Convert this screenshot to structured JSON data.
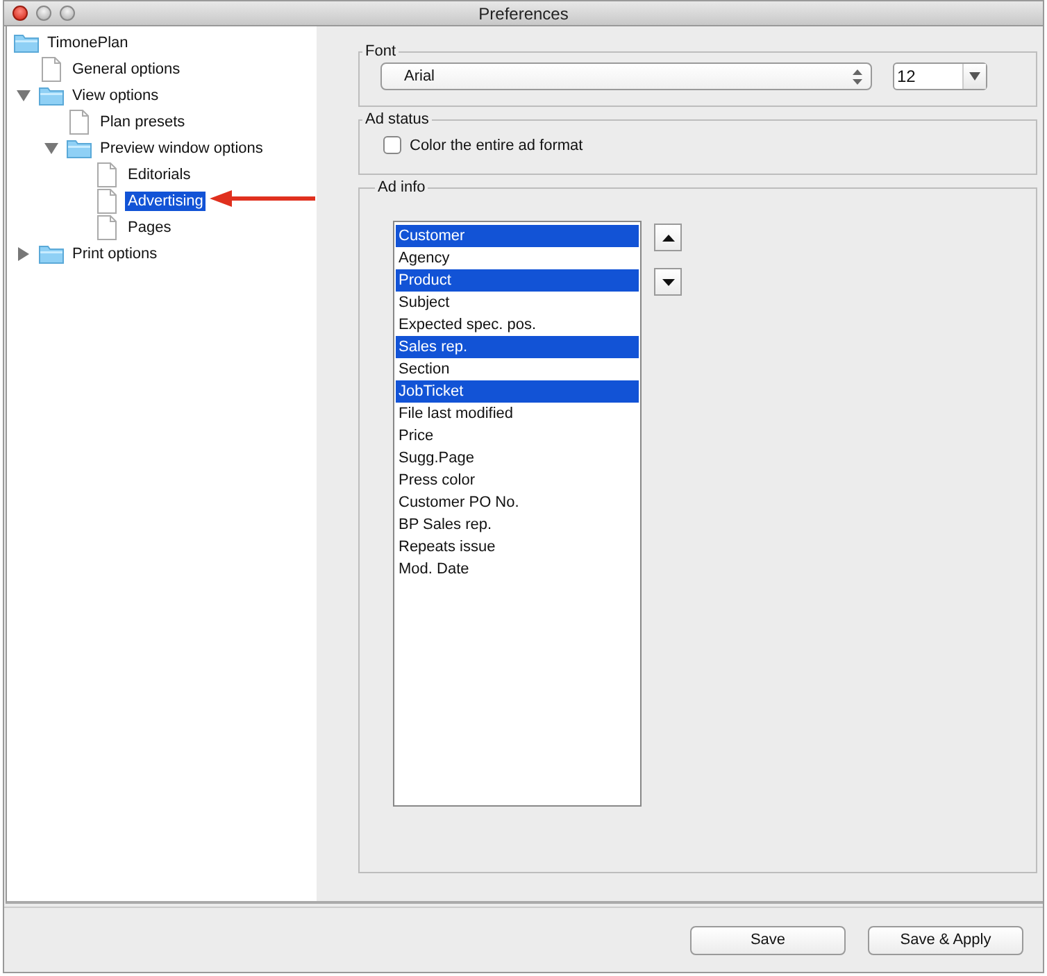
{
  "window": {
    "title": "Preferences"
  },
  "tree": {
    "label": "TimonePlan",
    "kind": "folder",
    "selected": false,
    "children": [
      {
        "label": "General options",
        "kind": "page",
        "selected": false
      },
      {
        "label": "View options",
        "kind": "folder",
        "expanded": true,
        "selected": false,
        "children": [
          {
            "label": "Plan presets",
            "kind": "page",
            "selected": false
          },
          {
            "label": "Preview window options",
            "kind": "folder",
            "expanded": true,
            "selected": false,
            "children": [
              {
                "label": "Editorials",
                "kind": "page",
                "selected": false
              },
              {
                "label": "Advertising",
                "kind": "page",
                "selected": true
              },
              {
                "label": "Pages",
                "kind": "page",
                "selected": false
              }
            ]
          }
        ]
      },
      {
        "label": "Print options",
        "kind": "folder",
        "expanded": false,
        "selected": false
      }
    ]
  },
  "font": {
    "label": "Font",
    "family": "Arial",
    "size": "12"
  },
  "ad_status": {
    "label": "Ad status",
    "checkbox": {
      "label": "Color the entire ad format",
      "checked": false
    }
  },
  "ad_info": {
    "label": "Ad info",
    "items": [
      {
        "label": "Customer",
        "selected": true
      },
      {
        "label": "Agency",
        "selected": false
      },
      {
        "label": "Product",
        "selected": true
      },
      {
        "label": "Subject",
        "selected": false
      },
      {
        "label": "Expected spec. pos.",
        "selected": false
      },
      {
        "label": "Sales rep.",
        "selected": true
      },
      {
        "label": "Section",
        "selected": false
      },
      {
        "label": "JobTicket",
        "selected": true
      },
      {
        "label": "File last modified",
        "selected": false
      },
      {
        "label": "Price",
        "selected": false
      },
      {
        "label": "Sugg.Page",
        "selected": false
      },
      {
        "label": "Press color",
        "selected": false
      },
      {
        "label": "Customer PO No.",
        "selected": false
      },
      {
        "label": "BP Sales rep.",
        "selected": false
      },
      {
        "label": "Repeats issue",
        "selected": false
      },
      {
        "label": "Mod. Date",
        "selected": false
      }
    ]
  },
  "buttons": [
    "Save",
    "Save & Apply"
  ]
}
